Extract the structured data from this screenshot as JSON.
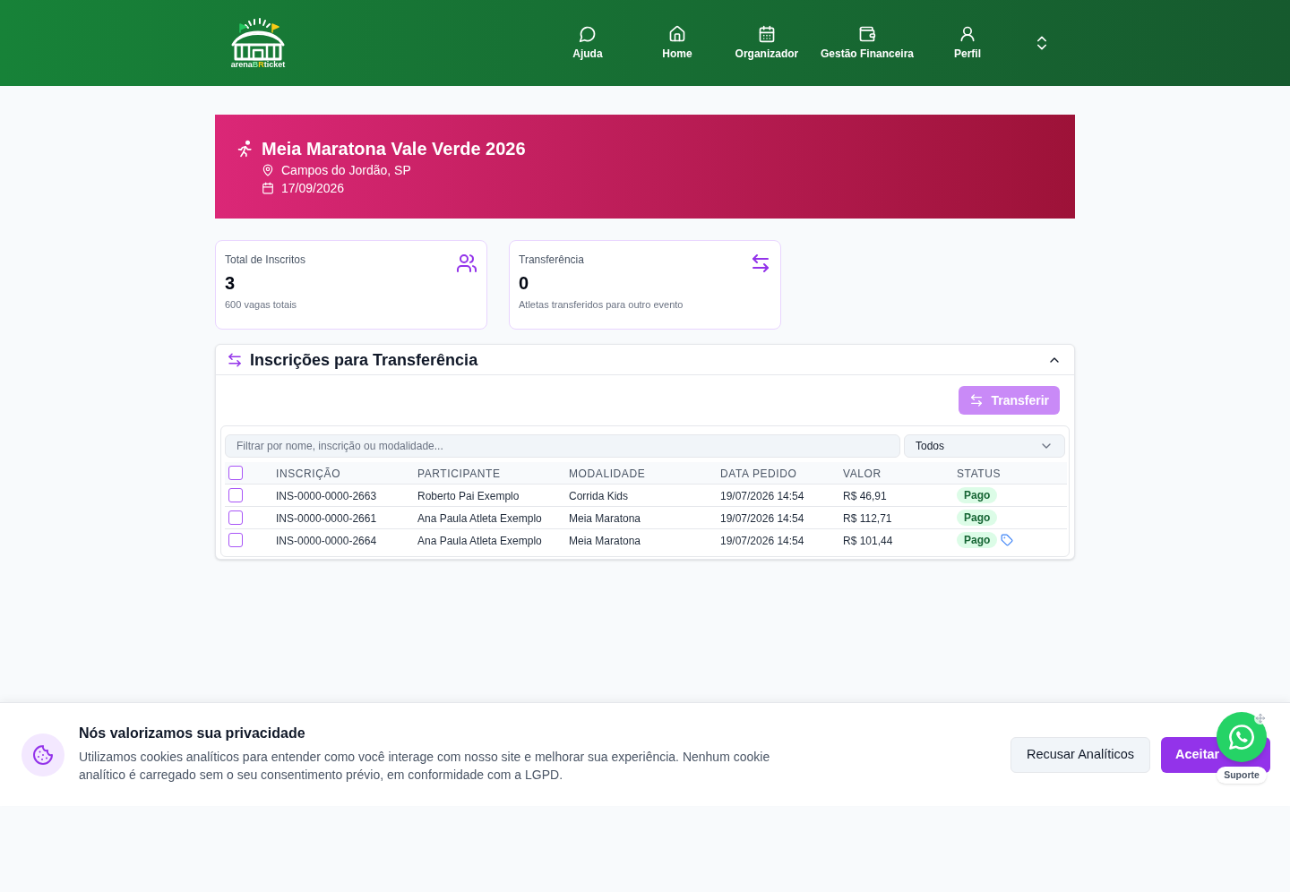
{
  "header": {
    "logo": {
      "wordmark": [
        {
          "text": "arena",
          "color": "#ffffff"
        },
        {
          "text": "B",
          "color": "#86efac"
        },
        {
          "text": "R",
          "color": "#facc15"
        },
        {
          "text": "ticket",
          "color": "#ffffff"
        }
      ]
    },
    "nav": [
      {
        "label": "Ajuda"
      },
      {
        "label": "Home"
      },
      {
        "label": "Organizador"
      },
      {
        "label": "Gestão Financeira"
      },
      {
        "label": "Perfil"
      }
    ]
  },
  "event_banner": {
    "title": "Meia Maratona Vale Verde 2026",
    "location": "Campos do Jordão, SP",
    "date": "17/09/2026"
  },
  "stats": [
    {
      "label": "Total de Inscritos",
      "value": "3",
      "caption": "600 vagas totais"
    },
    {
      "label": "Transferência",
      "value": "0",
      "caption": "Atletas transferidos para outro evento"
    }
  ],
  "transfer_section": {
    "title": "Inscrições para Transferência",
    "expanded": true,
    "transfer_button": {
      "label": "Transferir",
      "disabled": true
    },
    "filter": {
      "placeholder": "Filtrar por nome, inscrição ou modalidade..."
    },
    "status_select": {
      "value": "Todos"
    },
    "table": {
      "select_all_checked": false,
      "columns": [
        "INSCRIÇÃO",
        "PARTICIPANTE",
        "MODALIDADE",
        "DATA PEDIDO",
        "VALOR",
        "STATUS"
      ],
      "rows": [
        {
          "checked": false,
          "cells": [
            "INS-0000-0000-2663",
            "Roberto Pai Exemplo",
            "Corrida Kids",
            "19/07/2026 14:54",
            "R$ 46,91"
          ],
          "status": "Pago",
          "tagged": false
        },
        {
          "checked": false,
          "cells": [
            "INS-0000-0000-2661",
            "Ana Paula Atleta Exemplo",
            "Meia Maratona",
            "19/07/2026 14:54",
            "R$ 112,71"
          ],
          "status": "Pago",
          "tagged": false
        },
        {
          "checked": false,
          "cells": [
            "INS-0000-0000-2664",
            "Ana Paula Atleta Exemplo",
            "Meia Maratona",
            "19/07/2026 14:54",
            "R$ 101,44"
          ],
          "status": "Pago",
          "tagged": true
        }
      ]
    }
  },
  "cookie_banner": {
    "title": "Nós valorizamos sua privacidade",
    "text": "Utilizamos cookies analíticos para entender como você interage com nosso site e melhorar sua experiência. Nenhum cookie analítico é carregado sem o seu consentimento prévio, em conformidade com a LGPD.",
    "buttons": [
      {
        "label": "Recusar Analíticos",
        "kind": "secondary"
      },
      {
        "label": "Aceitar",
        "kind": "primary"
      }
    ]
  },
  "support_widget": {
    "label": "Suporte"
  }
}
